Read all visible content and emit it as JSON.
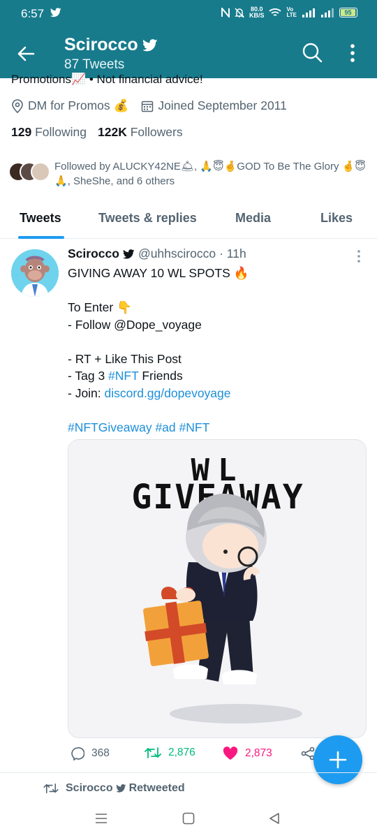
{
  "status": {
    "time": "6:57",
    "speed_value": "80.0",
    "speed_unit": "KB/S",
    "lte_top": "Vo",
    "lte_bottom": "LTE",
    "battery": "95"
  },
  "header": {
    "title": "Scirocco",
    "tweet_count": "87 Tweets"
  },
  "profile": {
    "bio_cut": "Promotions📈 • Not financial advice!",
    "dm_label": "DM for Promos 💰",
    "joined": "Joined September 2011",
    "following_count": "129",
    "following_label": "Following",
    "followers_count": "122K",
    "followers_label": "Followers",
    "followed_by": "Followed by ALUCKY42NE🛎, 🙏😇🤞GOD To Be The Glory 🤞😇🙏, SheShe, and 6 others"
  },
  "tabs": [
    "Tweets",
    "Tweets & replies",
    "Media",
    "Likes"
  ],
  "tweet": {
    "name": "Scirocco",
    "handle": "@uhhscirocco",
    "time": "· 11h",
    "line1": "GIVING AWAY 10 WL SPOTS 🔥",
    "line2": "To Enter 👇",
    "line3": "- Follow @Dope_voyage",
    "line4": "- RT + Like This Post",
    "line5_prefix": "- Tag 3 ",
    "line5_tag": "#NFT",
    "line5_suffix": " Friends",
    "line6_prefix": "- Join: ",
    "line6_link": "discord.gg/dopevoyage",
    "hashtags": "#NFTGiveaway #ad #NFT",
    "media_title_1": "WL",
    "media_title_2": "GIVEAWAY",
    "replies": "368",
    "retweets": "2,876",
    "likes": "2,873"
  },
  "retweeted": {
    "name": "Scirocco",
    "label": "Retweeted"
  },
  "colors": {
    "brand": "#177b8c",
    "link": "#1d8fd9",
    "fab": "#1d9bf0",
    "retweet": "#00ba7c",
    "like": "#f91880"
  }
}
